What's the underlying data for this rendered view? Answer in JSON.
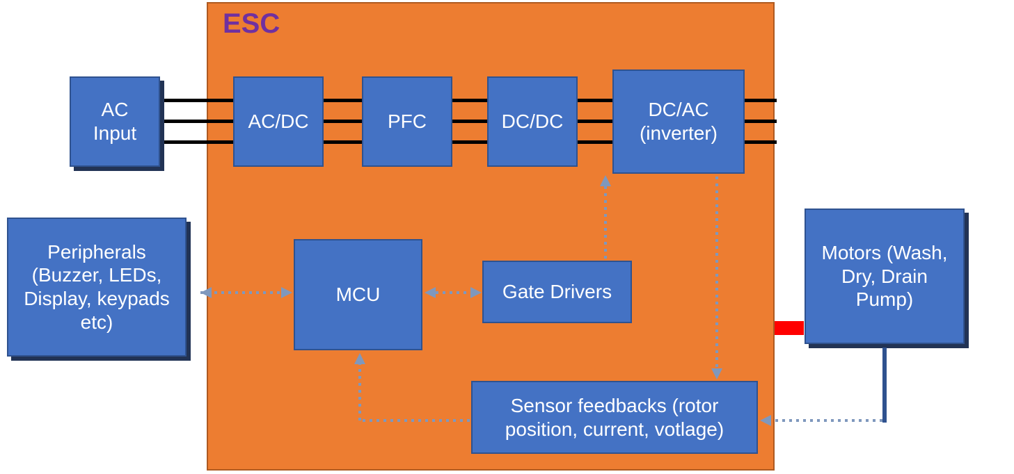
{
  "esc_label": "ESC",
  "blocks": {
    "ac_input": "AC\nInput",
    "peripherals": "Peripherals (Buzzer, LEDs, Display, keypads etc)",
    "acdc": "AC/DC",
    "pfc": "PFC",
    "dcdc": "DC/DC",
    "dcac": "DC/AC (inverter)",
    "mcu": "MCU",
    "gate_drivers": "Gate Drivers",
    "sensor": "Sensor feedbacks (rotor position, current, votlage)",
    "motors": "Motors (Wash, Dry, Drain Pump)"
  }
}
